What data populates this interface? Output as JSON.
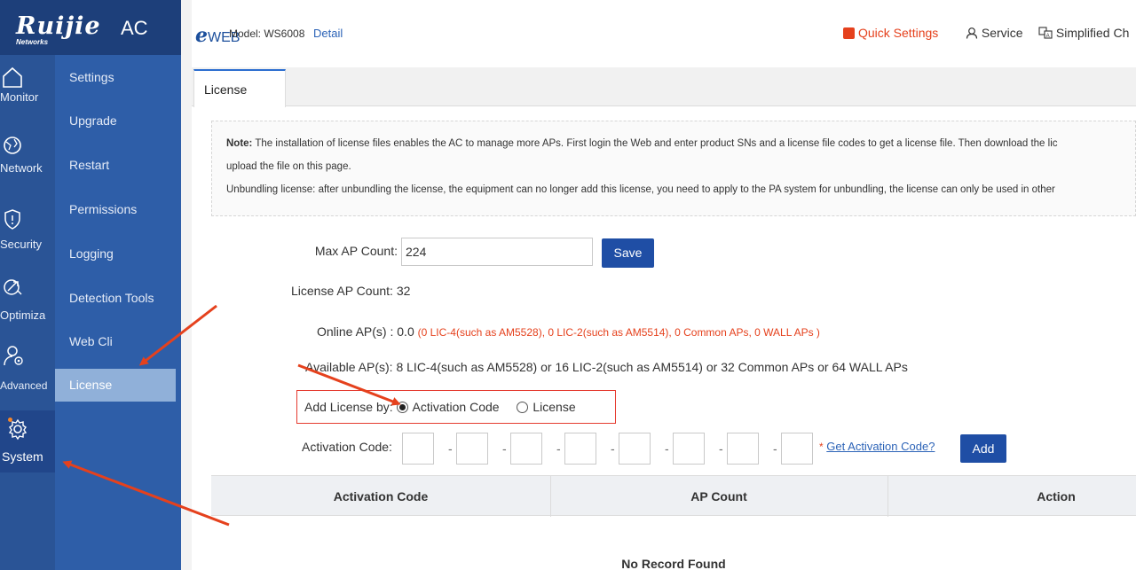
{
  "brand": {
    "logo_text": "Ruijie",
    "logo_sub": "Networks",
    "product": "AC"
  },
  "header": {
    "eweb_e": "e",
    "eweb_text": "WEB",
    "model": "Model: WS6008",
    "detail": "Detail",
    "quick_settings": "Quick Settings",
    "service": "Service",
    "language": "Simplified Ch"
  },
  "rail": [
    {
      "label": "Monitor",
      "icon": "home-icon"
    },
    {
      "label": "Network",
      "icon": "globe-icon"
    },
    {
      "label": "Security",
      "icon": "shield-icon"
    },
    {
      "label": "Optimiza",
      "icon": "rocket-icon"
    },
    {
      "label": "Advanced",
      "icon": "user-gear-icon"
    },
    {
      "label": "System",
      "icon": "gear-icon"
    }
  ],
  "submenu": [
    "Settings",
    "Upgrade",
    "Restart",
    "Permissions",
    "Logging",
    "Detection Tools",
    "Web Cli",
    "License"
  ],
  "tab": "License",
  "note": {
    "prefix": "Note:",
    "line1": " The installation of license files enables the AC to manage more APs. First login the Web and enter product SNs and a license file codes to get a license file. Then download the lic",
    "line2": "upload the file on this page.",
    "line3": "Unbundling license: after unbundling the license, the equipment can no longer add this license, you need to apply to the PA system for unbundling, the license can only be used in other"
  },
  "form": {
    "max_ap_label": "Max AP Count:",
    "max_ap_value": "224",
    "save": "Save",
    "license_ap_label": "License AP Count:",
    "license_ap_value": "32",
    "online_label": "Online AP(s) :",
    "online_value": "0.0",
    "online_detail": "(0 LIC-4(such as AM5528), 0 LIC-2(such as AM5514), 0 Common APs, 0 WALL APs )",
    "available_label": "Available AP(s):",
    "available_value": "8 LIC-4(such as AM5528) or 16 LIC-2(such as AM5514) or 32 Common APs or 64 WALL APs",
    "add_by_label": "Add License by:",
    "opt_activation": "Activation Code",
    "opt_license": "License",
    "activation_label": "Activation Code:",
    "dash": "-",
    "get_code_star": "*",
    "get_code": "Get Activation Code?",
    "add": "Add"
  },
  "table": {
    "columns": [
      "Activation Code",
      "AP Count",
      "Action"
    ],
    "empty": "No Record Found"
  },
  "colors": {
    "accent": "#1f4ea5",
    "rail": "#2a5496",
    "submenu": "#2e5ea8",
    "annotation": "#e5411d"
  }
}
